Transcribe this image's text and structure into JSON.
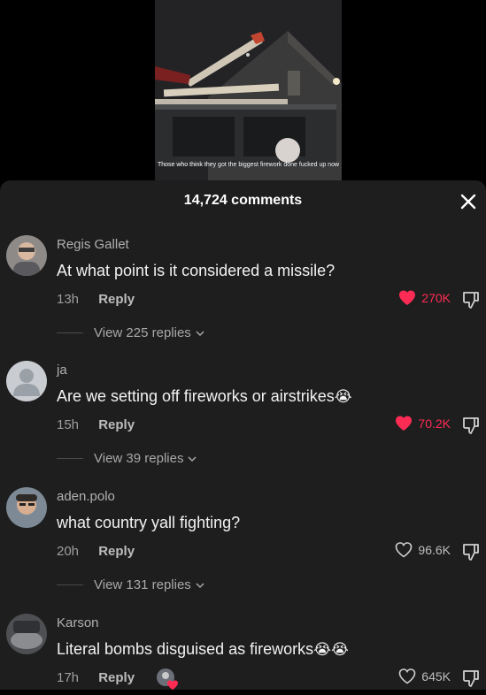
{
  "video": {
    "caption": "Those who think they got the biggest firework done fucked up now"
  },
  "sheet": {
    "comment_count": "14,724 comments"
  },
  "comments": [
    {
      "username": "Regis Gallet",
      "text": "At what point is it considered a missile?",
      "time": "13h",
      "reply_label": "Reply",
      "likes": "270K",
      "liked": true,
      "view_replies": "View 225 replies"
    },
    {
      "username": "ja",
      "text": "Are we setting off fireworks or airstrikes",
      "emoji": "😭",
      "time": "15h",
      "reply_label": "Reply",
      "likes": "70.2K",
      "liked": true,
      "view_replies": "View 39 replies"
    },
    {
      "username": "aden.polo",
      "text": "what country yall fighting?",
      "time": "20h",
      "reply_label": "Reply",
      "likes": "96.6K",
      "liked": false,
      "view_replies": "View 131 replies"
    },
    {
      "username": "Karson",
      "text": "Literal bombs disguised as fireworks",
      "emoji": "😭😭",
      "time": "17h",
      "reply_label": "Reply",
      "likes": "645K",
      "liked": false
    }
  ],
  "colors": {
    "sheet_bg": "#1e1e1e",
    "like_active": "#fe2c55",
    "muted_text": "#9e9e9e"
  },
  "icons": {
    "heart": "heart-icon",
    "dislike": "thumbs-down-icon",
    "close": "close-icon",
    "chevron": "chevron-down-icon"
  }
}
